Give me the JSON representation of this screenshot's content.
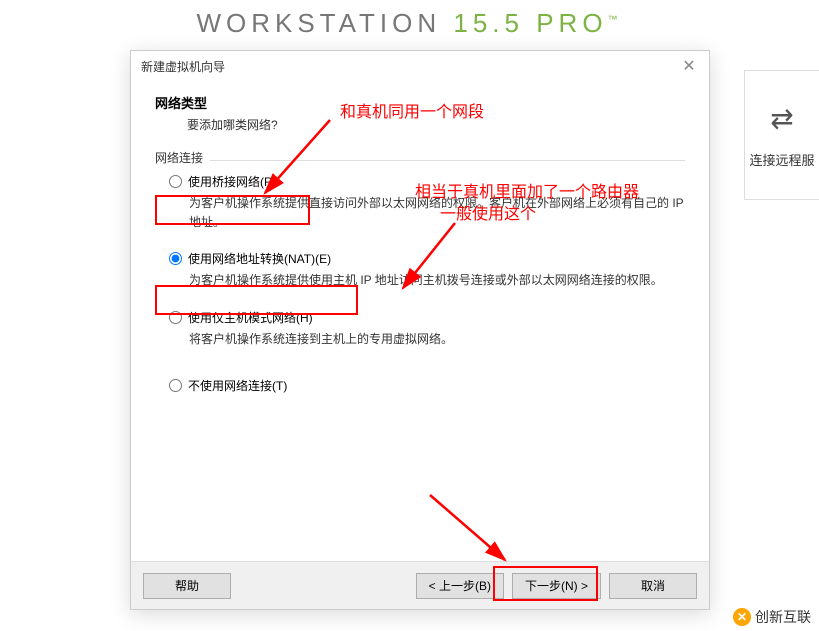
{
  "bg": {
    "brand_a": "WORKSTATION ",
    "brand_b": "15.5 PRO",
    "tm": "™",
    "right_label": "连接远程服"
  },
  "dialog": {
    "title": "新建虚拟机向导",
    "header_title": "网络类型",
    "header_subtitle": "要添加哪类网络?",
    "fieldset": "网络连接",
    "options": [
      {
        "label": "使用桥接网络(R)",
        "desc": "为客户机操作系统提供直接访问外部以太网网络的权限。客户机在外部网络上必须有自己的 IP 地址。",
        "checked": false
      },
      {
        "label": "使用网络地址转换(NAT)(E)",
        "desc": "为客户机操作系统提供使用主机 IP 地址访问主机拨号连接或外部以太网网络连接的权限。",
        "checked": true
      },
      {
        "label": "使用仅主机模式网络(H)",
        "desc": "将客户机操作系统连接到主机上的专用虚拟网络。",
        "checked": false
      },
      {
        "label": "不使用网络连接(T)",
        "desc": "",
        "checked": false
      }
    ],
    "buttons": {
      "help": "帮助",
      "back": "< 上一步(B)",
      "next": "下一步(N) >",
      "cancel": "取消"
    }
  },
  "annotations": {
    "note1": "和真机同用一个网段",
    "note2a": "相当于真机里面加了一个路由器",
    "note2b": "一般使用这个"
  },
  "watermark": "创新互联"
}
